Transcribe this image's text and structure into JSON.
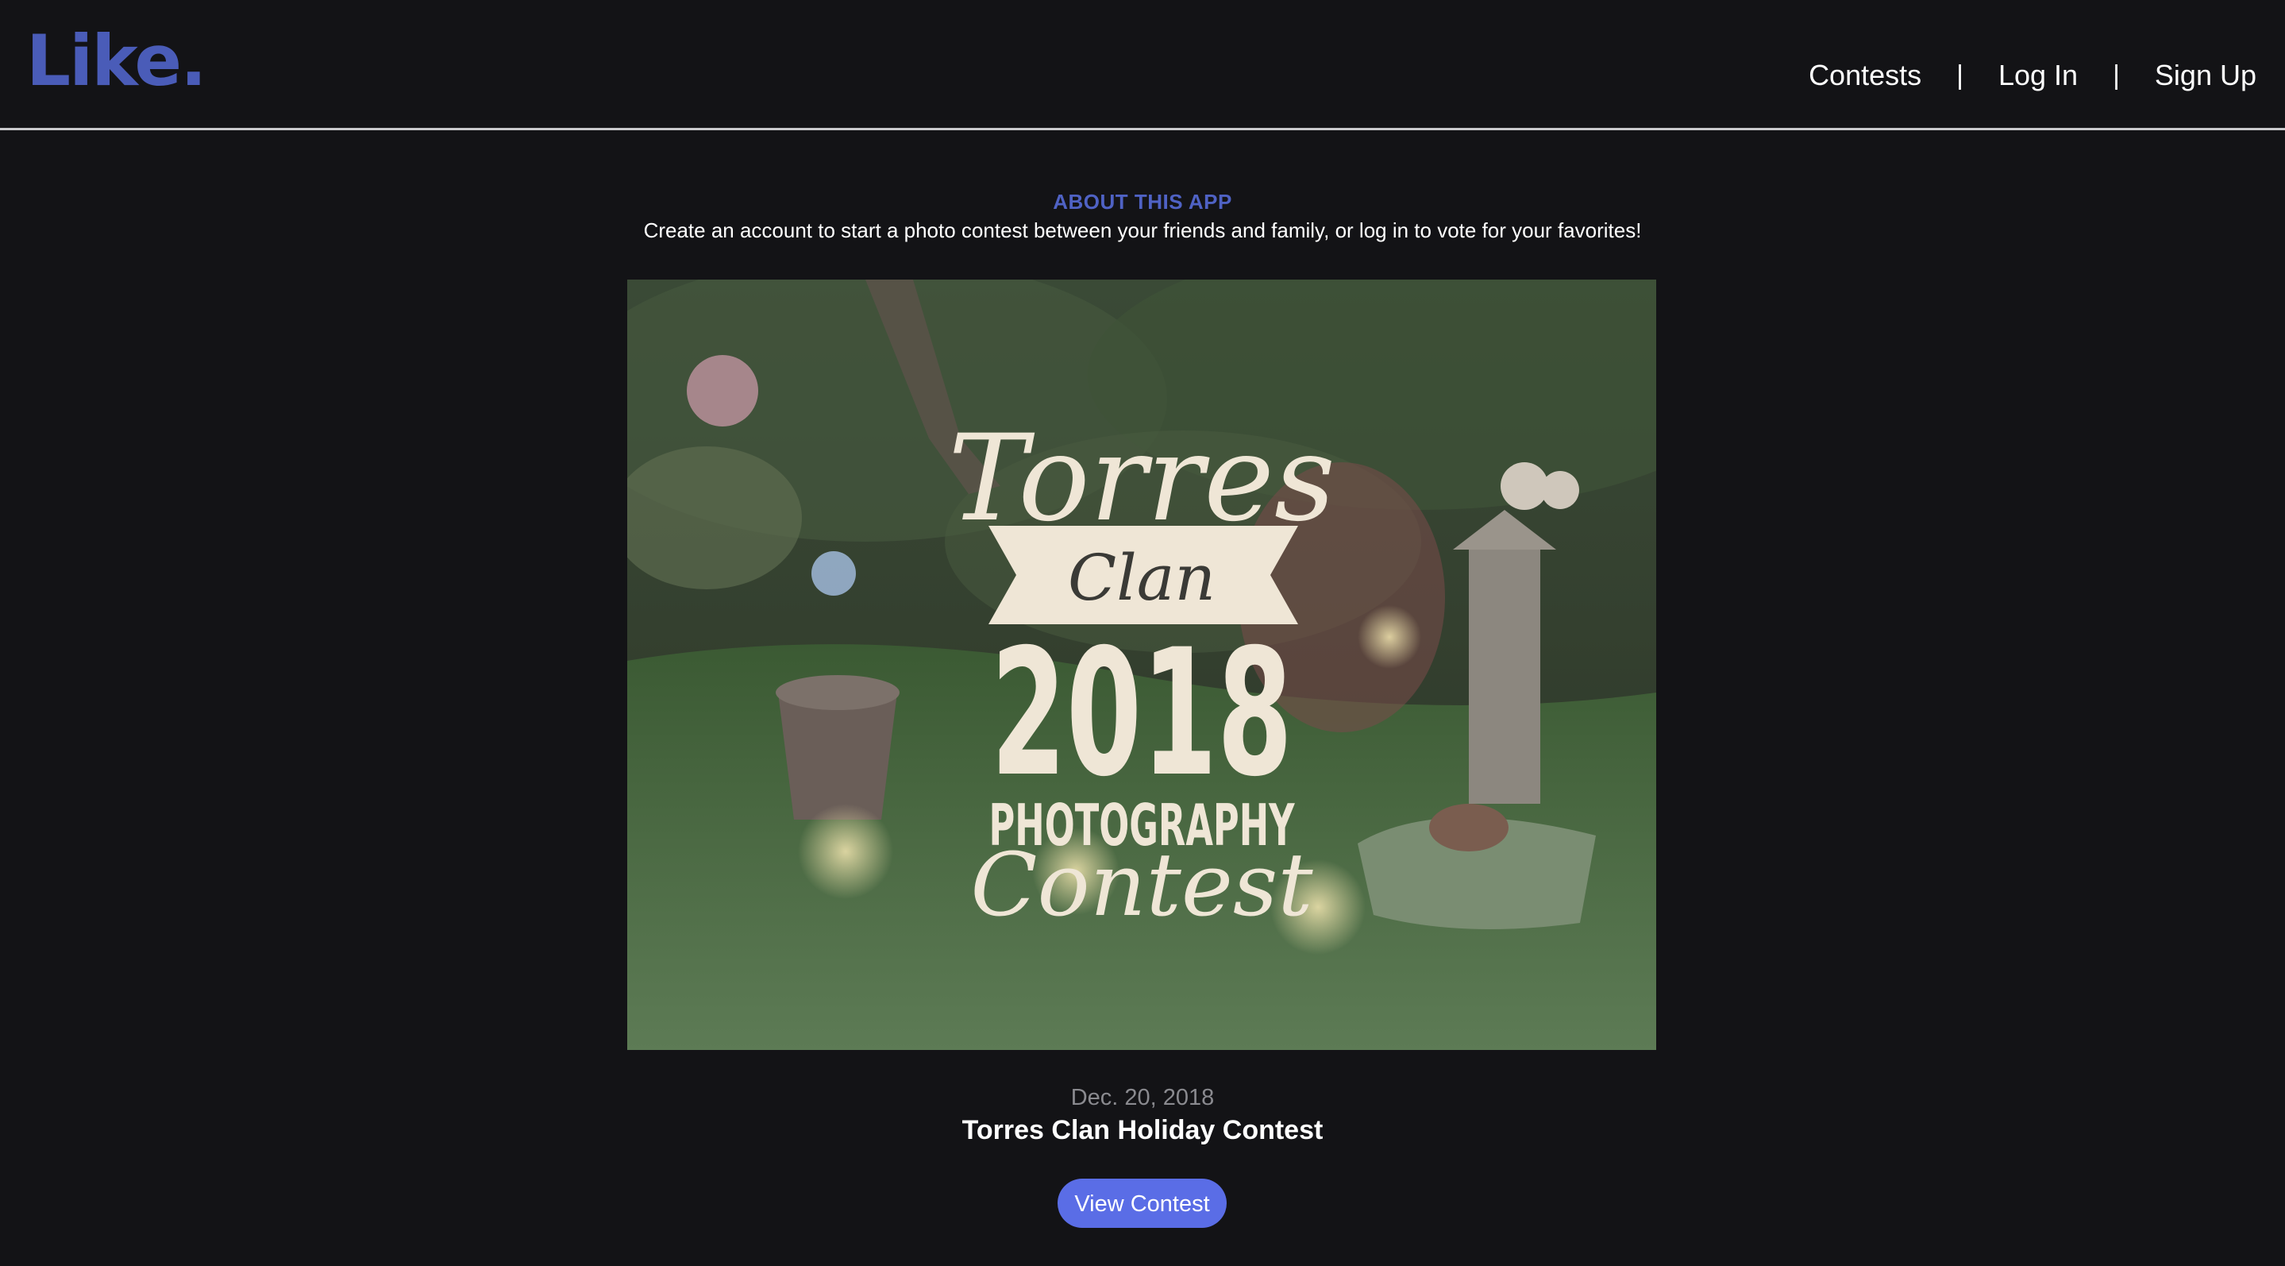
{
  "header": {
    "logo": "Like.",
    "nav": {
      "contests": "Contests",
      "separator": "|",
      "login": "Log In",
      "signup": "Sign Up"
    }
  },
  "about": {
    "title": "ABOUT THIS APP",
    "text": "Create an account to start a photo contest between your friends and family, or log in to vote for your favorites!"
  },
  "contest": {
    "image": {
      "line1": "Torres",
      "line2": "Clan",
      "line3": "2018",
      "line4": "PHOTOGRAPHY",
      "line5": "Contest"
    },
    "date": "Dec. 20, 2018",
    "title": "Torres Clan Holiday Contest",
    "button": "View Contest"
  },
  "colors": {
    "background": "#131316",
    "brand": "#4a5cb8",
    "accent_title": "#4f62c4",
    "button": "#5a6de6"
  }
}
